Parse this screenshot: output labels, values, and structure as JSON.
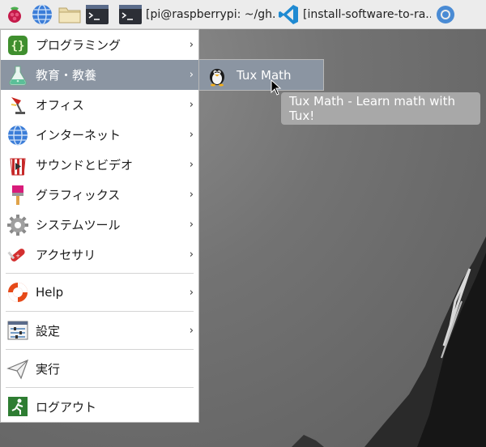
{
  "taskbar": {
    "tasks": [
      {
        "label": "[pi@raspberrypi: ~/gh..."
      },
      {
        "label": "[install-software-to-ra..."
      }
    ]
  },
  "menu": {
    "items": [
      {
        "label": "プログラミング",
        "has_submenu": true
      },
      {
        "label": "教育・教養",
        "has_submenu": true
      },
      {
        "label": "オフィス",
        "has_submenu": true
      },
      {
        "label": "インターネット",
        "has_submenu": true
      },
      {
        "label": "サウンドとビデオ",
        "has_submenu": true
      },
      {
        "label": "グラフィックス",
        "has_submenu": true
      },
      {
        "label": "システムツール",
        "has_submenu": true
      },
      {
        "label": "アクセサリ",
        "has_submenu": true
      },
      {
        "label": "Help",
        "has_submenu": true
      },
      {
        "label": "設定",
        "has_submenu": true
      },
      {
        "label": "実行",
        "has_submenu": false
      },
      {
        "label": "ログアウト",
        "has_submenu": false
      }
    ]
  },
  "submenu": {
    "items": [
      {
        "label": "Tux Math"
      }
    ]
  },
  "tooltip": {
    "text": "Tux Math - Learn math with Tux!"
  },
  "arrow_glyph": "›",
  "colors": {
    "highlight": "#8b95a2",
    "tooltip_bg": "#a8a8a8"
  }
}
